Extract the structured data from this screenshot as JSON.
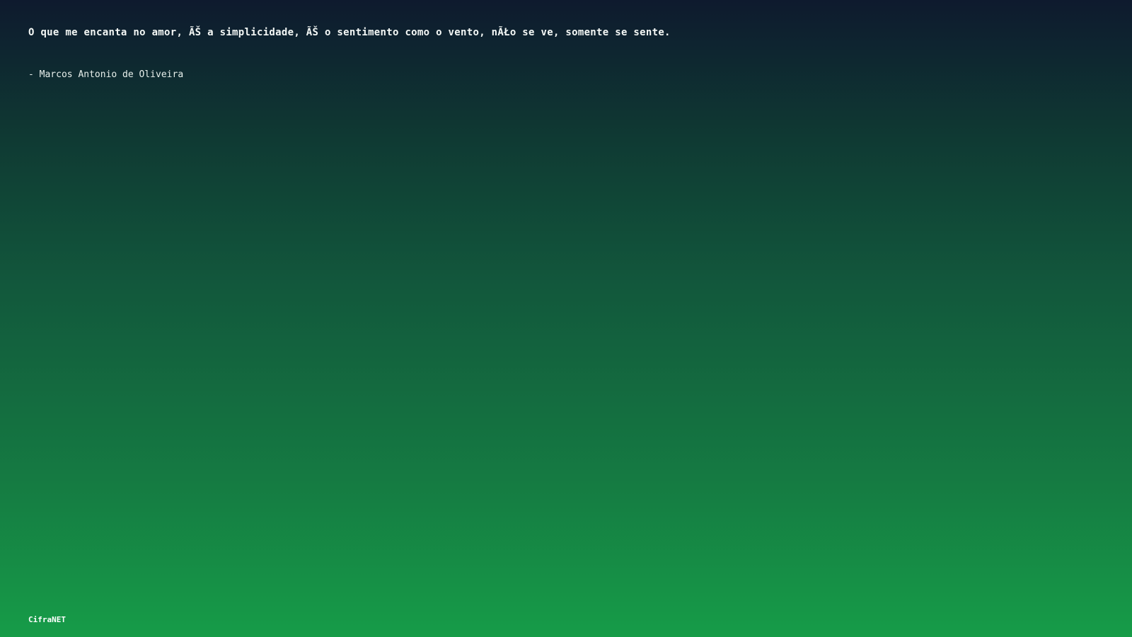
{
  "quote": {
    "text": "O que me encanta no amor, ÃŠ a simplicidade, ÃŠ o sentimento como o vento, nÃŁo se ve, somente se sente.",
    "author": "- Marcos Antonio de Oliveira"
  },
  "footer": {
    "brand": "CifraNET"
  },
  "colors": {
    "gradient_top": "#0e1a2e",
    "gradient_bottom": "#169c48",
    "text": "#ffffff"
  }
}
